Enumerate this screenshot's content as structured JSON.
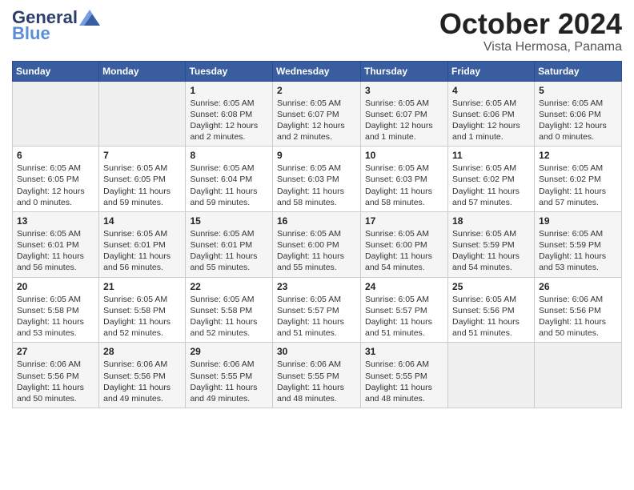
{
  "header": {
    "logo_line1": "General",
    "logo_line2": "Blue",
    "month": "October 2024",
    "location": "Vista Hermosa, Panama"
  },
  "weekdays": [
    "Sunday",
    "Monday",
    "Tuesday",
    "Wednesday",
    "Thursday",
    "Friday",
    "Saturday"
  ],
  "weeks": [
    [
      {
        "day": "",
        "detail": ""
      },
      {
        "day": "",
        "detail": ""
      },
      {
        "day": "1",
        "detail": "Sunrise: 6:05 AM\nSunset: 6:08 PM\nDaylight: 12 hours\nand 2 minutes."
      },
      {
        "day": "2",
        "detail": "Sunrise: 6:05 AM\nSunset: 6:07 PM\nDaylight: 12 hours\nand 2 minutes."
      },
      {
        "day": "3",
        "detail": "Sunrise: 6:05 AM\nSunset: 6:07 PM\nDaylight: 12 hours\nand 1 minute."
      },
      {
        "day": "4",
        "detail": "Sunrise: 6:05 AM\nSunset: 6:06 PM\nDaylight: 12 hours\nand 1 minute."
      },
      {
        "day": "5",
        "detail": "Sunrise: 6:05 AM\nSunset: 6:06 PM\nDaylight: 12 hours\nand 0 minutes."
      }
    ],
    [
      {
        "day": "6",
        "detail": "Sunrise: 6:05 AM\nSunset: 6:05 PM\nDaylight: 12 hours\nand 0 minutes."
      },
      {
        "day": "7",
        "detail": "Sunrise: 6:05 AM\nSunset: 6:05 PM\nDaylight: 11 hours\nand 59 minutes."
      },
      {
        "day": "8",
        "detail": "Sunrise: 6:05 AM\nSunset: 6:04 PM\nDaylight: 11 hours\nand 59 minutes."
      },
      {
        "day": "9",
        "detail": "Sunrise: 6:05 AM\nSunset: 6:03 PM\nDaylight: 11 hours\nand 58 minutes."
      },
      {
        "day": "10",
        "detail": "Sunrise: 6:05 AM\nSunset: 6:03 PM\nDaylight: 11 hours\nand 58 minutes."
      },
      {
        "day": "11",
        "detail": "Sunrise: 6:05 AM\nSunset: 6:02 PM\nDaylight: 11 hours\nand 57 minutes."
      },
      {
        "day": "12",
        "detail": "Sunrise: 6:05 AM\nSunset: 6:02 PM\nDaylight: 11 hours\nand 57 minutes."
      }
    ],
    [
      {
        "day": "13",
        "detail": "Sunrise: 6:05 AM\nSunset: 6:01 PM\nDaylight: 11 hours\nand 56 minutes."
      },
      {
        "day": "14",
        "detail": "Sunrise: 6:05 AM\nSunset: 6:01 PM\nDaylight: 11 hours\nand 56 minutes."
      },
      {
        "day": "15",
        "detail": "Sunrise: 6:05 AM\nSunset: 6:01 PM\nDaylight: 11 hours\nand 55 minutes."
      },
      {
        "day": "16",
        "detail": "Sunrise: 6:05 AM\nSunset: 6:00 PM\nDaylight: 11 hours\nand 55 minutes."
      },
      {
        "day": "17",
        "detail": "Sunrise: 6:05 AM\nSunset: 6:00 PM\nDaylight: 11 hours\nand 54 minutes."
      },
      {
        "day": "18",
        "detail": "Sunrise: 6:05 AM\nSunset: 5:59 PM\nDaylight: 11 hours\nand 54 minutes."
      },
      {
        "day": "19",
        "detail": "Sunrise: 6:05 AM\nSunset: 5:59 PM\nDaylight: 11 hours\nand 53 minutes."
      }
    ],
    [
      {
        "day": "20",
        "detail": "Sunrise: 6:05 AM\nSunset: 5:58 PM\nDaylight: 11 hours\nand 53 minutes."
      },
      {
        "day": "21",
        "detail": "Sunrise: 6:05 AM\nSunset: 5:58 PM\nDaylight: 11 hours\nand 52 minutes."
      },
      {
        "day": "22",
        "detail": "Sunrise: 6:05 AM\nSunset: 5:58 PM\nDaylight: 11 hours\nand 52 minutes."
      },
      {
        "day": "23",
        "detail": "Sunrise: 6:05 AM\nSunset: 5:57 PM\nDaylight: 11 hours\nand 51 minutes."
      },
      {
        "day": "24",
        "detail": "Sunrise: 6:05 AM\nSunset: 5:57 PM\nDaylight: 11 hours\nand 51 minutes."
      },
      {
        "day": "25",
        "detail": "Sunrise: 6:05 AM\nSunset: 5:56 PM\nDaylight: 11 hours\nand 51 minutes."
      },
      {
        "day": "26",
        "detail": "Sunrise: 6:06 AM\nSunset: 5:56 PM\nDaylight: 11 hours\nand 50 minutes."
      }
    ],
    [
      {
        "day": "27",
        "detail": "Sunrise: 6:06 AM\nSunset: 5:56 PM\nDaylight: 11 hours\nand 50 minutes."
      },
      {
        "day": "28",
        "detail": "Sunrise: 6:06 AM\nSunset: 5:56 PM\nDaylight: 11 hours\nand 49 minutes."
      },
      {
        "day": "29",
        "detail": "Sunrise: 6:06 AM\nSunset: 5:55 PM\nDaylight: 11 hours\nand 49 minutes."
      },
      {
        "day": "30",
        "detail": "Sunrise: 6:06 AM\nSunset: 5:55 PM\nDaylight: 11 hours\nand 48 minutes."
      },
      {
        "day": "31",
        "detail": "Sunrise: 6:06 AM\nSunset: 5:55 PM\nDaylight: 11 hours\nand 48 minutes."
      },
      {
        "day": "",
        "detail": ""
      },
      {
        "day": "",
        "detail": ""
      }
    ]
  ]
}
